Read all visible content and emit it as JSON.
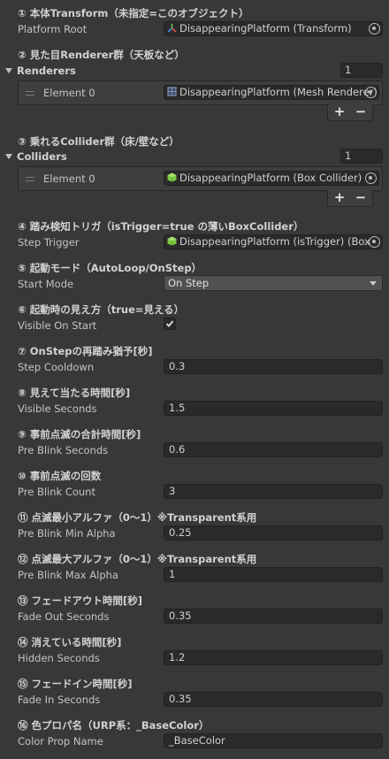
{
  "sections": {
    "s1": {
      "header": "① 本体Transform（未指定=このオブジェクト）",
      "label": "Platform Root",
      "value": "DisappearingPlatform  (Transform)"
    },
    "s2": {
      "header": "② 見た目Renderer群（天板など）",
      "foldout": "Renderers",
      "count": "1",
      "element_label": "Element 0",
      "value": "DisappearingPlatform  (Mesh Renderer)"
    },
    "s3": {
      "header": "③ 乗れるCollider群（床/壁など）",
      "foldout": "Colliders",
      "count": "1",
      "element_label": "Element 0",
      "value": "DisappearingPlatform  (Box Collider)"
    },
    "s4": {
      "header": "④ 踏み検知トリガ（isTrigger=true の薄いBoxCollider）",
      "label": "Step Trigger",
      "value": "DisappearingPlatform  (isTrigger) (Box"
    },
    "s5": {
      "header": "⑤ 起動モード（AutoLoop/OnStep）",
      "label": "Start Mode",
      "value": "On Step"
    },
    "s6": {
      "header": "⑥ 起動時の見え方（true=見える）",
      "label": "Visible On Start",
      "checked": true
    },
    "s7": {
      "header": "⑦ OnStepの再踏み猶予[秒]",
      "label": "Step Cooldown",
      "value": "0.3"
    },
    "s8": {
      "header": "⑧ 見えて当たる時間[秒]",
      "label": "Visible Seconds",
      "value": "1.5"
    },
    "s9": {
      "header": "⑨ 事前点滅の合計時間[秒]",
      "label": "Pre Blink Seconds",
      "value": "0.6"
    },
    "s10": {
      "header": "⑩ 事前点滅の回数",
      "label": "Pre Blink Count",
      "value": "3"
    },
    "s11": {
      "header": "⑪ 点滅最小アルファ（0〜1）※Transparent系用",
      "label": "Pre Blink Min Alpha",
      "value": "0.25"
    },
    "s12": {
      "header": "⑫ 点滅最大アルファ（0〜1）※Transparent系用",
      "label": "Pre Blink Max Alpha",
      "value": "1"
    },
    "s13": {
      "header": "⑬ フェードアウト時間[秒]",
      "label": "Fade Out Seconds",
      "value": "0.35"
    },
    "s14": {
      "header": "⑭ 消えている時間[秒]",
      "label": "Hidden Seconds",
      "value": "1.2"
    },
    "s15": {
      "header": "⑮ フェードイン時間[秒]",
      "label": "Fade In Seconds",
      "value": "0.35"
    },
    "s16": {
      "header": "⑯ 色プロパ名（URP系：_BaseColor）",
      "label": "Color Prop Name",
      "value": "_BaseColor"
    }
  },
  "buttons": {
    "plus": "+",
    "minus": "−"
  },
  "icons": {
    "transform": "transform-axes-icon",
    "mesh_renderer": "mesh-renderer-icon",
    "box_collider": "green-cube-icon",
    "object_picker": "object-picker-icon",
    "checkmark": "checkmark-icon"
  },
  "colors": {
    "background": "#383838",
    "field": "#2a2a2a",
    "dropdown": "#515151",
    "collider_green": "#7ac943"
  }
}
